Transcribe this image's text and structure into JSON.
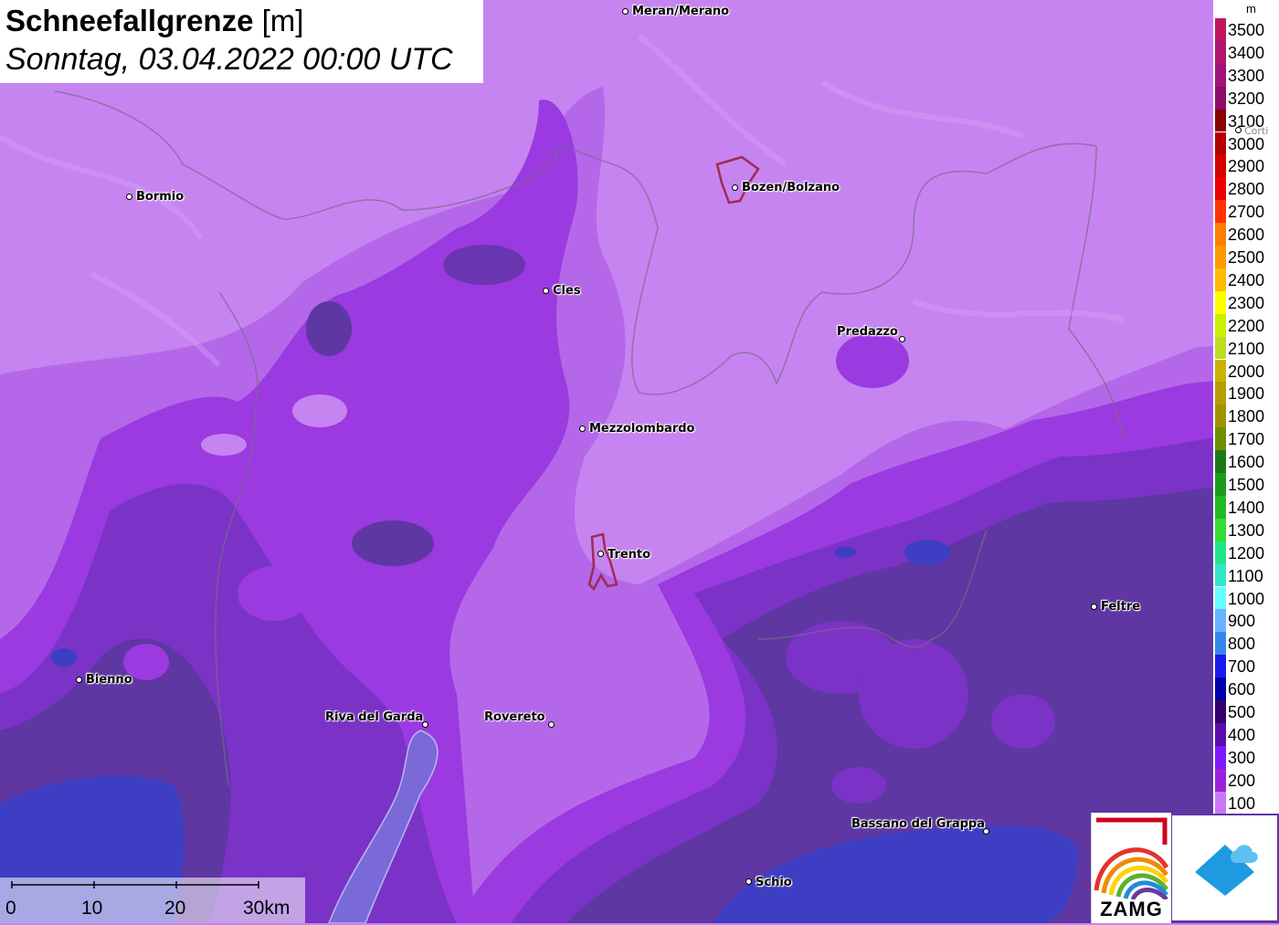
{
  "title": {
    "main": "Schneefallgrenze",
    "unit": "[m]",
    "subtitle": "Sonntag, 03.04.2022 00:00 UTC"
  },
  "legend": {
    "unit": "m",
    "items": [
      {
        "label": "3500",
        "color": "#c2185b"
      },
      {
        "label": "3400",
        "color": "#b0166e"
      },
      {
        "label": "3300",
        "color": "#a0137a"
      },
      {
        "label": "3200",
        "color": "#8b0c6a"
      },
      {
        "label": "3100",
        "color": "#8b0000"
      },
      {
        "label": "3000",
        "color": "#b30000"
      },
      {
        "label": "2900",
        "color": "#d40000"
      },
      {
        "label": "2800",
        "color": "#ee0000"
      },
      {
        "label": "2700",
        "color": "#ff3300"
      },
      {
        "label": "2600",
        "color": "#ff7f00"
      },
      {
        "label": "2500",
        "color": "#ff9900"
      },
      {
        "label": "2400",
        "color": "#ffbb00"
      },
      {
        "label": "2300",
        "color": "#ffff00"
      },
      {
        "label": "2200",
        "color": "#ccee00"
      },
      {
        "label": "2100",
        "color": "#bbdd22"
      },
      {
        "label": "2000",
        "color": "#c8b400"
      },
      {
        "label": "1900",
        "color": "#b89b00"
      },
      {
        "label": "1800",
        "color": "#9e9400"
      },
      {
        "label": "1700",
        "color": "#6f8f00"
      },
      {
        "label": "1600",
        "color": "#1a7a1a"
      },
      {
        "label": "1500",
        "color": "#1a9e1a"
      },
      {
        "label": "1400",
        "color": "#22bb22"
      },
      {
        "label": "1300",
        "color": "#33dd33"
      },
      {
        "label": "1200",
        "color": "#22e58a"
      },
      {
        "label": "1100",
        "color": "#33e8c8"
      },
      {
        "label": "1000",
        "color": "#66ffff"
      },
      {
        "label": "900",
        "color": "#66b3ff"
      },
      {
        "label": "800",
        "color": "#3388ee"
      },
      {
        "label": "700",
        "color": "#1a1aee"
      },
      {
        "label": "600",
        "color": "#0000aa"
      },
      {
        "label": "500",
        "color": "#33006b"
      },
      {
        "label": "400",
        "color": "#5a0dab"
      },
      {
        "label": "300",
        "color": "#7f1aff"
      },
      {
        "label": "200",
        "color": "#9b22dd"
      },
      {
        "label": "100",
        "color": "#c978f5"
      }
    ]
  },
  "cities": [
    {
      "name": "Meran/Merano"
    },
    {
      "name": "Bormio"
    },
    {
      "name": "Bozen/Bolzano"
    },
    {
      "name": "Cles"
    },
    {
      "name": "Predazzo"
    },
    {
      "name": "Mezzolombardo"
    },
    {
      "name": "Trento"
    },
    {
      "name": "Feltre"
    },
    {
      "name": "Bienno"
    },
    {
      "name": "Riva del Garda"
    },
    {
      "name": "Rovereto"
    },
    {
      "name": "Bassano del Grappa"
    },
    {
      "name": "Schio"
    },
    {
      "name": "Corti"
    }
  ],
  "scale": {
    "labels": [
      "0",
      "10",
      "20",
      "30km"
    ]
  },
  "logos": {
    "zamg": "ZAMG",
    "right_icon": "house-cloud-icon"
  },
  "colors": {
    "lightest": "#c684f0",
    "light": "#b163e8",
    "mid": "#9a33e6",
    "dark": "#7a2bd0",
    "darker": "#5a30a8",
    "darkest": "#5a3a9a",
    "blue": "#3a3acc"
  }
}
